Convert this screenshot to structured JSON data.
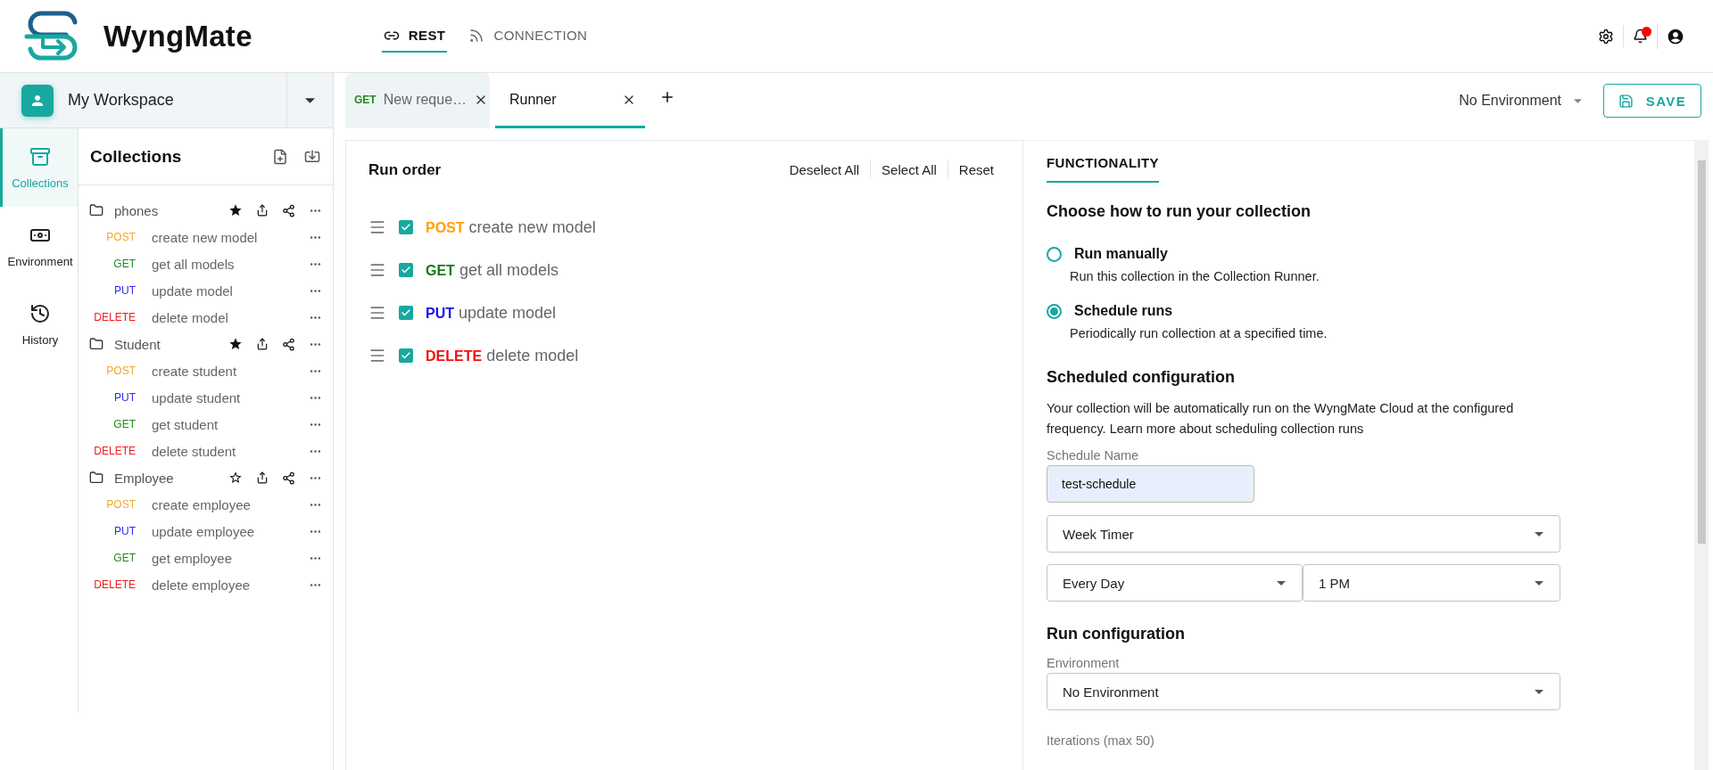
{
  "app": {
    "name": "WyngMate"
  },
  "nav_tabs": [
    {
      "label": "REST",
      "selected": true,
      "kind": "rest"
    },
    {
      "label": "CONNECTION",
      "selected": false,
      "kind": "connection"
    }
  ],
  "notifications": {
    "unread": true
  },
  "workspace": {
    "name": "My Workspace"
  },
  "rail": [
    {
      "label": "Collections",
      "selected": true,
      "kind": "collections"
    },
    {
      "label": "Environment",
      "selected": false,
      "kind": "environment"
    },
    {
      "label": "History",
      "selected": false,
      "kind": "history"
    }
  ],
  "collections": {
    "title": "Collections",
    "folders": [
      {
        "name": "phones",
        "starred": true,
        "children": [
          {
            "method": "POST",
            "color": "#f5a623",
            "name": "create new model"
          },
          {
            "method": "GET",
            "color": "#1e8c1e",
            "name": "get all models"
          },
          {
            "method": "PUT",
            "color": "#2b2bf0",
            "name": "update model"
          },
          {
            "method": "DELETE",
            "color": "#f01c1c",
            "name": "delete model"
          }
        ]
      },
      {
        "name": "Student",
        "starred": true,
        "children": [
          {
            "method": "POST",
            "color": "#f5a623",
            "name": "create student"
          },
          {
            "method": "PUT",
            "color": "#2b2bf0",
            "name": "update student"
          },
          {
            "method": "GET",
            "color": "#1e8c1e",
            "name": "get student"
          },
          {
            "method": "DELETE",
            "color": "#f01c1c",
            "name": "delete student"
          }
        ]
      },
      {
        "name": "Employee",
        "starred": false,
        "children": [
          {
            "method": "POST",
            "color": "#f5a623",
            "name": "create employee"
          },
          {
            "method": "PUT",
            "color": "#2b2bf0",
            "name": "update employee"
          },
          {
            "method": "GET",
            "color": "#1e8c1e",
            "name": "get employee"
          },
          {
            "method": "DELETE",
            "color": "#f01c1c",
            "name": "delete employee"
          }
        ]
      }
    ]
  },
  "request_tabs": [
    {
      "method": "GET",
      "color": "#1e8c1e",
      "label": "New reque…",
      "selected": false
    },
    {
      "label": "Runner",
      "selected": true
    }
  ],
  "environment": "No Environment",
  "save_label": "SAVE",
  "run_order": {
    "title": "Run order",
    "actions": [
      "Deselect All",
      "Select All",
      "Reset"
    ],
    "items": [
      {
        "method": "POST",
        "color": "#ffa000",
        "name": "create new model",
        "checked": true
      },
      {
        "method": "GET",
        "color": "#157a15",
        "name": "get all models",
        "checked": true
      },
      {
        "method": "PUT",
        "color": "#1010f0",
        "name": "update model",
        "checked": true
      },
      {
        "method": "DELETE",
        "color": "#f01010",
        "name": "delete model",
        "checked": true
      }
    ]
  },
  "functionality": {
    "tab": "FUNCTIONALITY",
    "heading": "Choose how to run your collection",
    "options": [
      {
        "label": "Run manually",
        "description": "Run this collection in the Collection Runner.",
        "selected": false
      },
      {
        "label": "Schedule runs",
        "description": "Periodically run collection at a specified time.",
        "selected": true
      }
    ],
    "scheduled": {
      "heading": "Scheduled configuration",
      "description": "Your collection will be automatically run on the WyngMate Cloud at the configured frequency. Learn more about scheduling collection runs",
      "name_label": "Schedule Name",
      "name_value": "test-schedule",
      "timer": "Week Timer",
      "day": "Every Day",
      "time": "1 PM"
    },
    "run_config": {
      "heading": "Run configuration",
      "environment_label": "Environment",
      "environment": "No Environment",
      "iterations_label": "Iterations (max 50)"
    }
  }
}
